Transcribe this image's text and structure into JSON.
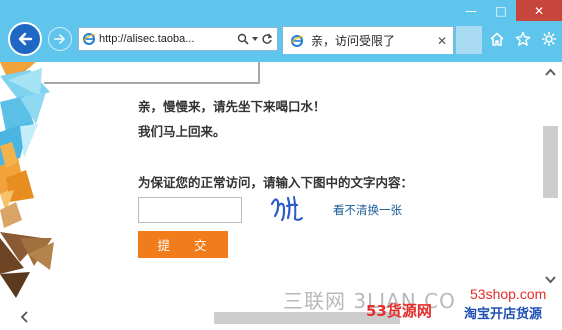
{
  "browser": {
    "address": "http://alisec.taoba...",
    "tab_title": "亲，访问受限了",
    "window_controls": {
      "minimize": "—",
      "maximize": "□",
      "close": "✕"
    },
    "icons": [
      "back-arrow-icon",
      "forward-arrow-icon",
      "ie-logo-icon",
      "search-icon",
      "dropdown-icon",
      "refresh-icon",
      "close-icon",
      "home-icon",
      "favorites-star-icon",
      "settings-gear-icon"
    ]
  },
  "page": {
    "message_line1": "亲，慢慢来，请先坐下来喝口水！",
    "message_line2": "我们马上回来。",
    "captcha_prompt": "为保证您的正常访问，请输入下图中的文字内容：",
    "captcha_input_value": "",
    "refresh_link": "看不清换一张",
    "submit_label": "提 交"
  },
  "watermarks": {
    "sanlian": "三联网 3LIAN.CO",
    "shop_url": "53shop.com",
    "brand": "53货源网",
    "slogan": "淘宝开店货源"
  },
  "colors": {
    "chrome": "#5fc5ec",
    "close_button": "#c7463c",
    "submit_button": "#f07c1c",
    "link": "#1b5d98",
    "watermark_red": "#e52e2a",
    "watermark_blue": "#1f4fb4"
  }
}
